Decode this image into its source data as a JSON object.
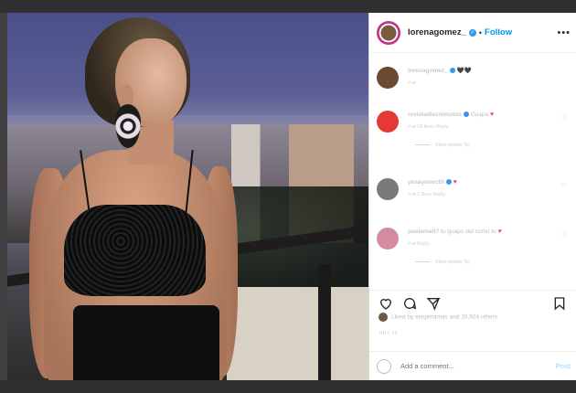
{
  "post": {
    "username": "lorenagomez_",
    "dot": "•",
    "follow_label": "Follow",
    "more_label": "•••"
  },
  "comments": [
    {
      "user": "lorenagomez_",
      "text": "🖤🖤",
      "meta": "4 w",
      "avatar_color": "#6b4a34",
      "has_heart": false,
      "replies": ""
    },
    {
      "user": "revistadiezminutos",
      "text": "Guapa",
      "meta": "4 w   18 likes   Reply",
      "avatar_color": "#e53935",
      "has_heart": true,
      "replies": "View replies (5)"
    },
    {
      "user": "yesaymarcfit",
      "text": "",
      "meta": "4 w   2 likes   Reply",
      "avatar_color": "#7a7a7a",
      "has_heart": true,
      "replies": ""
    },
    {
      "user": "paolamatt7",
      "text": "tu guapo del como tu",
      "meta": "4 w   Reply",
      "avatar_color": "#d48ba0",
      "has_heart": true,
      "replies": "View replies (5)"
    }
  ],
  "likes_text": "Liked by sergieramas and 10,924 others",
  "date_text": "JULY 26",
  "add_comment_placeholder": "Add a comment...",
  "post_button_label": "Post",
  "icons": [
    "heart-icon",
    "comment-icon",
    "share-icon",
    "bookmark-icon",
    "smile-icon"
  ]
}
